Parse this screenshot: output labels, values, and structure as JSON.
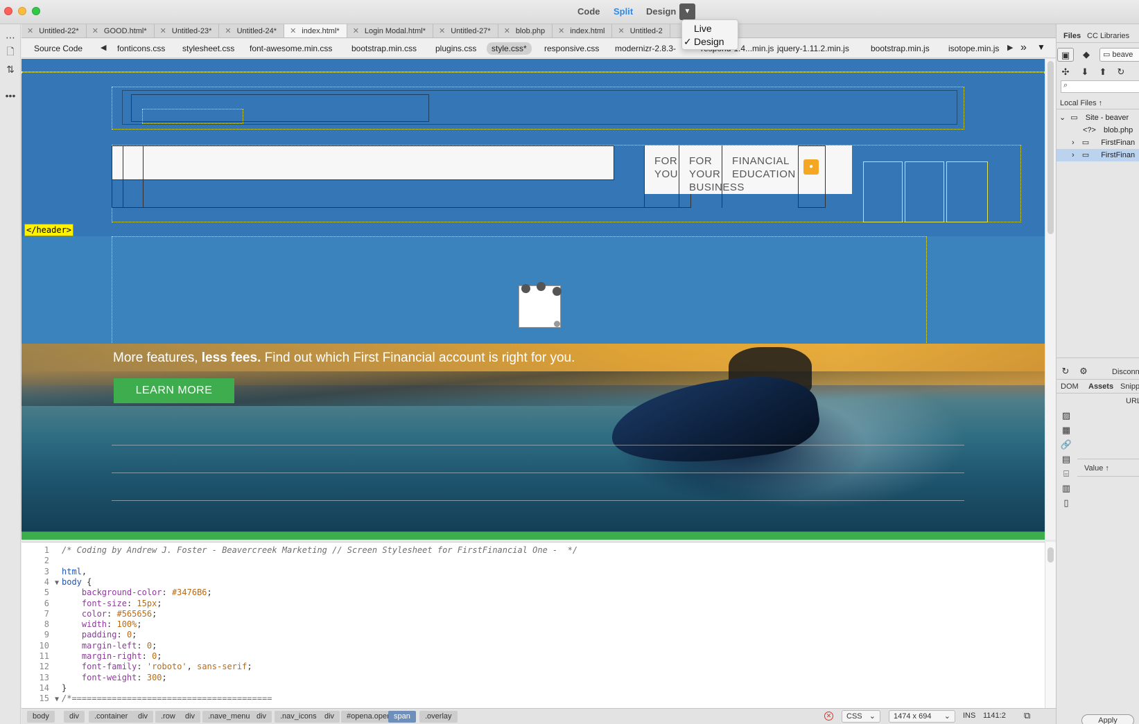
{
  "window": {
    "view_modes": {
      "code": "Code",
      "split": "Split",
      "design": "Design"
    },
    "dropdown_items": [
      {
        "label": "Live",
        "checked": false
      },
      {
        "label": "Design",
        "checked": true
      }
    ]
  },
  "tabs": [
    {
      "label": "Untitled-22*",
      "active": false
    },
    {
      "label": "GOOD.html*",
      "active": false
    },
    {
      "label": "Untitled-23*",
      "active": false
    },
    {
      "label": "Untitled-24*",
      "active": false
    },
    {
      "label": "index.html*",
      "active": true
    },
    {
      "label": "Login Modal.html*",
      "active": false
    },
    {
      "label": "Untitled-27*",
      "active": false
    },
    {
      "label": "blob.php",
      "active": false
    },
    {
      "label": "index.html",
      "active": false
    },
    {
      "label": "Untitled-2",
      "active": false
    }
  ],
  "related_files": {
    "source": "Source Code",
    "files": [
      "fonticons.css",
      "stylesheet.css",
      "font-awesome.min.css",
      "bootstrap.min.css",
      "plugins.css",
      "style.css*",
      "responsive.css",
      "modernizr-2.8.3-",
      "respond-1.4...min.js",
      "jquery-1.11.2.min.js",
      "bootstrap.min.js",
      "isotope.min.js"
    ],
    "active_file": "style.css*",
    "more": "»"
  },
  "design": {
    "nav_items": [
      "FOR YOU",
      "FOR YOUR BUSINESS",
      "FINANCIAL EDUCATION"
    ],
    "header_tag": "</header>",
    "hero_text_normal": "More features, ",
    "hero_text_bold": "less fees.",
    "hero_text_rest": " Find out which First Financial account is right for you.",
    "learn_more": "LEARN MORE",
    "colors": {
      "background": "#3476b6",
      "hero_top": "#3b83bd",
      "button_green": "#3dad4d",
      "header_tag_yellow": "#fff200"
    }
  },
  "code_lines": [
    {
      "n": "1",
      "fold": "",
      "html": "<span class=\"c-comment\">/* Coding by Andrew J. Foster - Beavercreek Marketing // Screen Stylesheet for FirstFinancial One -  */</span>"
    },
    {
      "n": "2",
      "fold": "",
      "html": ""
    },
    {
      "n": "3",
      "fold": "",
      "html": "<span class=\"c-sel\">html</span><span class=\"c-punct\">,</span>"
    },
    {
      "n": "4",
      "fold": "▼",
      "html": "<span class=\"c-sel\">body</span> <span class=\"c-punct\">{</span>"
    },
    {
      "n": "5",
      "fold": "",
      "html": "    <span class=\"c-prop\">background-color</span>: <span class=\"c-val\">#3476B6</span>;"
    },
    {
      "n": "6",
      "fold": "",
      "html": "    <span class=\"c-prop\">font-size</span>: <span class=\"c-val\">15px</span>;"
    },
    {
      "n": "7",
      "fold": "",
      "html": "    <span class=\"c-prop\">color</span>: <span class=\"c-val\">#565656</span>;"
    },
    {
      "n": "8",
      "fold": "",
      "html": "    <span class=\"c-prop\">width</span>: <span class=\"c-val\">100%</span>;"
    },
    {
      "n": "9",
      "fold": "",
      "html": "    <span class=\"c-prop\">padding</span>: <span class=\"c-val\">0</span>;"
    },
    {
      "n": "10",
      "fold": "",
      "html": "    <span class=\"c-prop\">margin-left</span>: <span class=\"c-val\">0</span>;"
    },
    {
      "n": "11",
      "fold": "",
      "html": "    <span class=\"c-prop\">margin-right</span>: <span class=\"c-val\">0</span>;"
    },
    {
      "n": "12",
      "fold": "",
      "html": "    <span class=\"c-prop\">font-family</span>: <span class=\"c-str\">'roboto'</span>, <span class=\"c-val\">sans-serif</span>;"
    },
    {
      "n": "13",
      "fold": "",
      "html": "    <span class=\"c-prop\">font-weight</span>: <span class=\"c-val\">300</span>;"
    },
    {
      "n": "14",
      "fold": "",
      "html": "<span class=\"c-punct\">}</span>"
    },
    {
      "n": "15",
      "fold": "▼",
      "html": "<span class=\"c-comment\">/*========================================</span>"
    }
  ],
  "statusbar": {
    "crumbs": [
      {
        "label": "body",
        "active": false
      },
      {
        "label": "div",
        "active": false
      },
      {
        "label": ".container",
        "active": false
      },
      {
        "label": "div",
        "active": false
      },
      {
        "label": ".row",
        "active": false
      },
      {
        "label": "div",
        "active": false
      },
      {
        "label": ".nave_menu",
        "active": false
      },
      {
        "label": "div",
        "active": false
      },
      {
        "label": ".nav_icons",
        "active": false
      },
      {
        "label": "div",
        "active": false
      },
      {
        "label": "#opena.open",
        "active": false
      },
      {
        "label": "span",
        "active": true
      },
      {
        "label": ".overlay",
        "active": false
      }
    ],
    "language": "CSS",
    "dimensions": "1474 x 694",
    "mode": "INS",
    "cursor": "1141:2"
  },
  "right_panel": {
    "tabs": [
      "Files",
      "CC Libraries"
    ],
    "site_select": "beave",
    "local_files_label": "Local Files ↑",
    "tree": [
      {
        "label": "Site - beaver",
        "indent": 0,
        "selected": false,
        "kind": "site"
      },
      {
        "label": "blob.php",
        "indent": 2,
        "selected": false,
        "kind": "php"
      },
      {
        "label": "FirstFinan",
        "indent": 1,
        "selected": false,
        "kind": "folder"
      },
      {
        "label": "FirstFinan",
        "indent": 1,
        "selected": true,
        "kind": "folder"
      }
    ],
    "bottom_tabs": [
      "DOM",
      "Assets",
      "Snipp"
    ],
    "disconnect": "Disconn",
    "url_label": "URL",
    "value_label": "Value ↑",
    "apply": "Apply"
  }
}
